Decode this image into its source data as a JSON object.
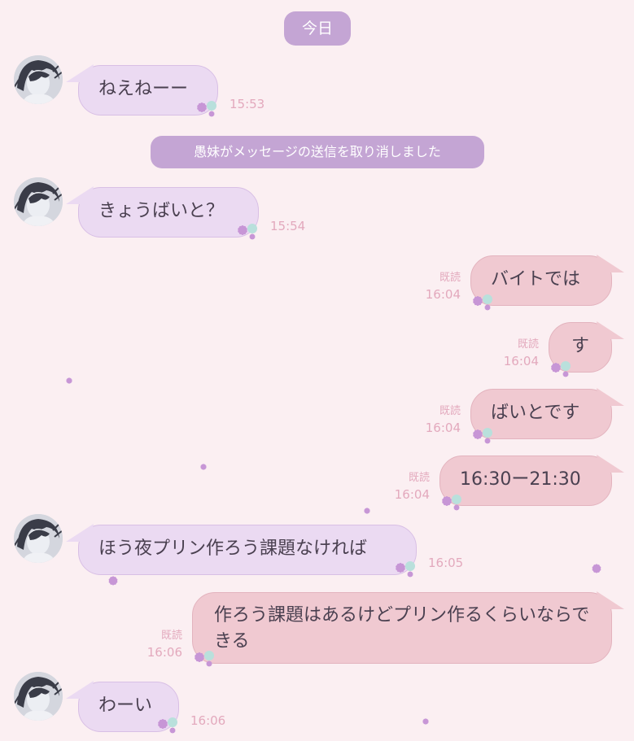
{
  "date_label": "今日",
  "system_message": "愚妹がメッセージの送信を取り消しました",
  "read_label": "既読",
  "colors": {
    "background": "#fbeff2",
    "incoming_bubble": "#ebdaf2",
    "outgoing_bubble": "#f0c9d1",
    "pill": "#c4a5d4",
    "timestamp": "#e3a9bd"
  },
  "messages": [
    {
      "side": "in",
      "text": "ねえねーー",
      "time": "15:53"
    },
    {
      "side": "in",
      "text": "きょうばいと？",
      "time": "15:54"
    },
    {
      "side": "out",
      "text": "バイトでは",
      "time": "16:04"
    },
    {
      "side": "out",
      "text": "す",
      "time": "16:04"
    },
    {
      "side": "out",
      "text": "ばいとです",
      "time": "16:04"
    },
    {
      "side": "out",
      "text": "16:30ー21:30",
      "time": "16:04"
    },
    {
      "side": "in",
      "text": "ほう夜プリン作ろう課題なければ",
      "time": "16:05"
    },
    {
      "side": "out",
      "text": "作ろう課題はあるけどプリン作るくらいならできる",
      "time": "16:06"
    },
    {
      "side": "in",
      "text": "わーい",
      "time": "16:06"
    }
  ]
}
